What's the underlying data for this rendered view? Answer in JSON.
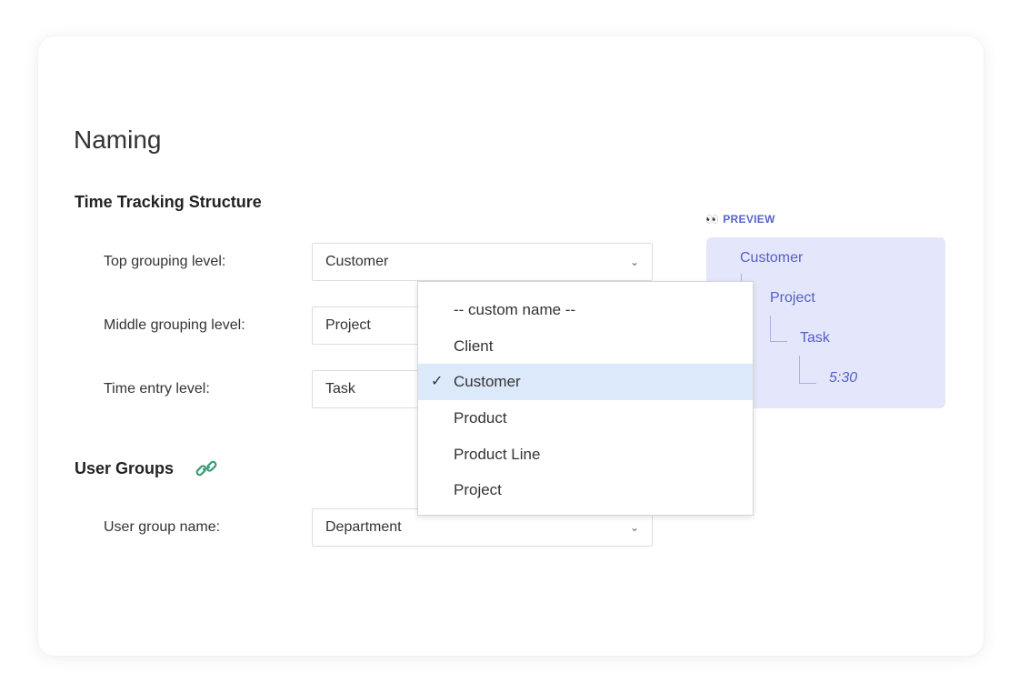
{
  "page": {
    "title": "Naming"
  },
  "time_tracking": {
    "heading": "Time Tracking Structure",
    "top": {
      "label": "Top grouping level:",
      "value": "Customer"
    },
    "middle": {
      "label": "Middle grouping level:",
      "value": "Project"
    },
    "entry": {
      "label": "Time entry level:",
      "value": "Task"
    }
  },
  "user_groups": {
    "heading": "User Groups",
    "link_icon": "link-icon",
    "name": {
      "label": "User group name:",
      "value": "Department"
    }
  },
  "preview": {
    "label": "PREVIEW",
    "eyes_icon": "👀",
    "top": "Customer",
    "middle": "Project",
    "entry": "Task",
    "time": "5:30"
  },
  "dropdown": {
    "check_icon": "✓",
    "selected_index": 2,
    "options": [
      "-- custom name --",
      "Client",
      "Customer",
      "Product",
      "Product Line",
      "Project"
    ]
  },
  "icons": {
    "chevron": "⌄"
  },
  "colors": {
    "accent": "#5560c4",
    "preview_bg": "#e4e7fb",
    "selected_bg": "#dce9fb",
    "link_icon": "#3a9a72"
  }
}
